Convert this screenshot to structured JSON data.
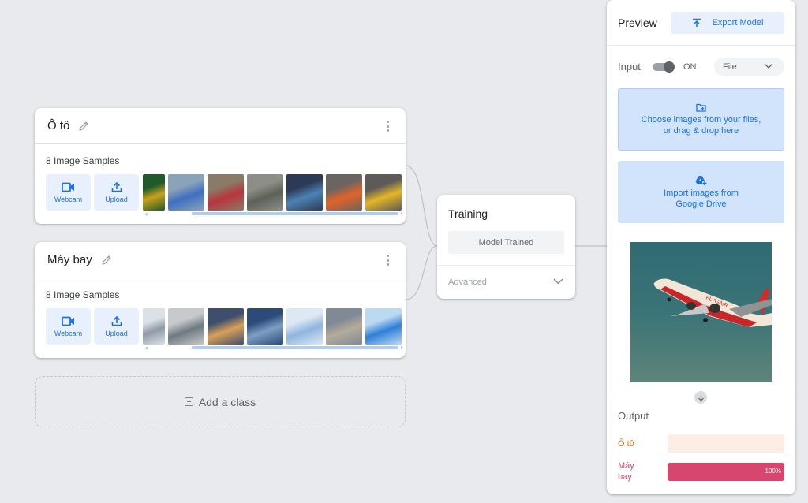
{
  "classes": [
    {
      "name": "Ô tô",
      "samples_label": "8 Image Samples",
      "webcam_label": "Webcam",
      "upload_label": "Upload",
      "thumb_colors": [
        [
          "#c9a21a",
          "#1f5a2a"
        ],
        [
          "#3f6fc0",
          "#8ba3b8"
        ],
        [
          "#b8353c",
          "#8a7a66"
        ],
        [
          "#5d6158",
          "#8d8f86"
        ],
        [
          "#4d82b5",
          "#2c3a55"
        ],
        [
          "#e0642a",
          "#6b6460"
        ],
        [
          "#e3b728",
          "#5d5a58"
        ]
      ]
    },
    {
      "name": "Máy bay",
      "samples_label": "8 Image Samples",
      "webcam_label": "Webcam",
      "upload_label": "Upload",
      "thumb_colors": [
        [
          "#8f9aa6",
          "#dce1e8"
        ],
        [
          "#6e7a80",
          "#c7c9cc"
        ],
        [
          "#d9a05a",
          "#3d4f6d"
        ],
        [
          "#7f9ec4",
          "#2c4a7a"
        ],
        [
          "#8fb5e0",
          "#dce8f3"
        ],
        [
          "#b5ab98",
          "#7f8a96"
        ],
        [
          "#2f7fd6",
          "#bcd9f2"
        ]
      ]
    }
  ],
  "add_class_label": "Add a class",
  "training": {
    "title": "Training",
    "button_label": "Model Trained",
    "advanced_label": "Advanced"
  },
  "preview": {
    "title": "Preview",
    "export_label": "Export Model",
    "input_label": "Input",
    "toggle_state": "ON",
    "source_select": "File",
    "files_drop_line1": "Choose images from your files,",
    "files_drop_line2": "or drag & drop here",
    "drive_line1": "Import images from",
    "drive_line2": "Google Drive",
    "output_title": "Output",
    "outputs": [
      {
        "label_line1": "Ô tô",
        "label_line2": "",
        "value": 0,
        "pct_text": "",
        "color": "#e8710a",
        "bar_bg": "#fdeee5"
      },
      {
        "label_line1": "Máy",
        "label_line2": "bay",
        "value": 100,
        "pct_text": "100%",
        "color": "#d7466c",
        "bar_bg": "#d7466c"
      }
    ]
  },
  "colors": {
    "accent": "#1a73e8",
    "tile_bg": "#e8f0fe",
    "drop_bg": "#d2e3fc"
  }
}
